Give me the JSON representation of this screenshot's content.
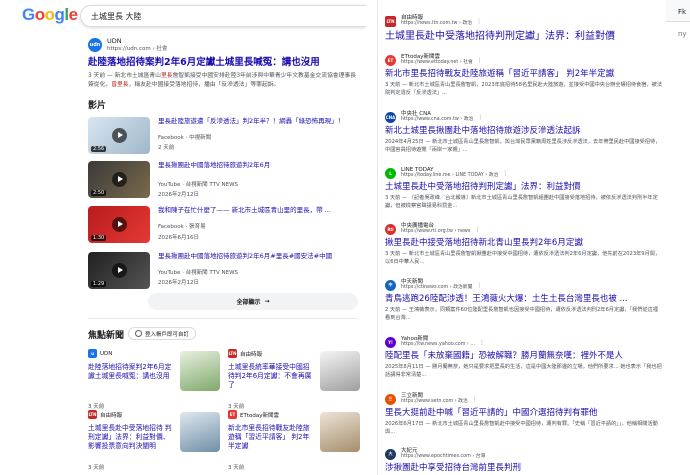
{
  "search": {
    "logo": [
      "G",
      "o",
      "o",
      "g",
      "l",
      "e"
    ],
    "query": "土城里長 大陸"
  },
  "result1": {
    "source": "UDN",
    "url": "https://udn.com › 社會",
    "title": "赴陸落地招待案判2年6月定讞土城里長喊冤：講也沒用",
    "snippet_pre": "3 天前 — 新北市土城區青山",
    "snippet_hl1": "里長",
    "snippet_mid": "詹智凱接受中國安排赴陸3年前涉與中華青少年文教基金交流協會理事長簽從化，",
    "snippet_hl2": "曾里長",
    "snippet_post": "，稱友赴中國接受落地招待，播由「反滲透法」等罪起訴。"
  },
  "videos": {
    "heading": "影片",
    "items": [
      {
        "title": "里長赴陸旅遊遭「反滲透法」判2年半？！網轟「綠恐怖再現」！",
        "source": "Facebook · 中視新聞",
        "date": "2 天前",
        "dur": "2:56"
      },
      {
        "title": "里長揪團赴中國落地招待旅遊判2年6月",
        "source": "YouTube · 台視新聞 TTV NEWS",
        "date": "2026年2月12日",
        "dur": "2:50"
      },
      {
        "title": "我和陳子在忙什麼了—— 新北市土城區青山里的里長，帶 ...",
        "source": "Facebook · 張育易",
        "date": "2026年6月16日",
        "dur": "1:30"
      },
      {
        "title": "里長揪團赴中國落地招待旅遊判2年6月#里長#國安法#中國",
        "source": "YouTube · 台視新聞 TTV NEWS",
        "date": "2026年2月12日",
        "dur": "1:29"
      }
    ],
    "show_all": "全部顯示"
  },
  "focus": {
    "heading": "焦點新聞",
    "login": "登入帳戶即可自訂",
    "cards": [
      {
        "src": "UDN",
        "title": "赴陸落地招待案判2年6月定讞土城里長喊冤：講也沒用",
        "time": "3 天前"
      },
      {
        "src": "自由時報",
        "title": "土城里長統率華接受中國招待判2年6月定讞：不會再厲了",
        "time": "3 天前"
      },
      {
        "src": "自由時報",
        "title": "土城里長赴中受落地招待 判刑定讞」法界：利益對價、影響投票意向判決闡明",
        "time": "3 天前"
      },
      {
        "src": "ETtoday新聞雲",
        "title": "新北市里長招待戰友赴陸旅遊稱「習近平請客」 判2年半定讞",
        "time": "3 天前"
      }
    ]
  },
  "right": [
    {
      "src": "自由時報",
      "url": "https://news.ltn.com.tw › 政治",
      "title": "土城里長赴中受落地招待判刑定讞」法界：利益對價",
      "snippet": "",
      "big": true
    },
    {
      "src": "ETtoday新聞雲",
      "url": "https://www.ettoday.net › 社會",
      "title": "新北市里長招待戰友赴陸旅遊稱「習近平請客」 判2年半定讞",
      "snippet": "3 天前 — 新北市土城區青山里長詹智凱，2023年底招待58名里民赴大陸旅遊，並接受中國中央台辦全權招待食宿，被法院判定違反「反滲透法」..."
    },
    {
      "src": "中央社 CNA",
      "url": "https://www.cna.com.tw › 政治",
      "title": "新北土城里長揪團赴中落地招待旅遊涉反滲透法起訴",
      "snippet": "2024年4月25日 — 新北市土城區青山里長詹智凱，與台灣民眾黨籍周姓里長涉反滲透法，去年帶里民赴中國接受招待，中國官員招待遊覽「兩岸一家親」..."
    },
    {
      "src": "LINE TODAY",
      "url": "https://today.line.me › LINE TODAY › 政治",
      "title": "土城里長赴中受落地招待判刑定讞」法界：利益對價",
      "snippet": "3 天前 — 〔記者吳政峰／台北報導〕新北市土城區青山里長詹智凱組團赴中國接受落地招待，被依反滲透法判刑半年定讞，但被檢察官聲請易科罰金..."
    },
    {
      "src": "中央廣播電台",
      "url": "https://www.rti.org.tw › news",
      "title": "揪里長赴中接受落地招待新北青山里長判2年6月定讞",
      "snippet": "3 天前 — 新北市土城區青山里長詹智凱揪團赴中接受中國招待，遭依反滲透法判2年6月定讞，他先前在2023年9月間，以6日中華人民..."
    },
    {
      "src": "中天新聞",
      "url": "https://ctinews.com › 政治新聞",
      "title": "青鳥逃跑26陸配涉透！王鴻薇火大爆：土生土長台灣里長也被 ...",
      "snippet": "2 天前 — 王鴻薇表示，同類案件60位陸配里長詹智凱也因接受中國招待，遭依反滲透法判刑2年6月定讞，「我們從這裡看到台灣..."
    },
    {
      "src": "Yahoo新聞",
      "url": "https://tw.news.yahoo.com › ...",
      "title": "陸配里長「未放棄國籍」恐被解職？勝月蘭無奈嘆：裡外不是人",
      "snippet": "2025年8月11日 — 勝月蘭無奈，她只是要求把里長的生活，這是中國大陸那邊的立場，他們所要求... 她也表示「我也把話講得非常清楚..."
    },
    {
      "src": "三立新聞",
      "url": "https://www.setn.com › 政治",
      "title": "里長大挺前赴中喊「習近平請的」中國介選招待判有罪他",
      "snippet": "2026年6月17日 — 新北市土城區青山里長詹智凱赴中接受中國招待，遭判有罪。「史稱「習近平請的」」，他稱相關活動與... "
    },
    {
      "src": "大紀元",
      "url": "https://www.epochtimes.com › 台灣",
      "title": "涉揪團赴中享受招待台灣前里長判刑",
      "snippet": ""
    }
  ],
  "cut": {
    "a": "Fk",
    "b": "ny"
  }
}
